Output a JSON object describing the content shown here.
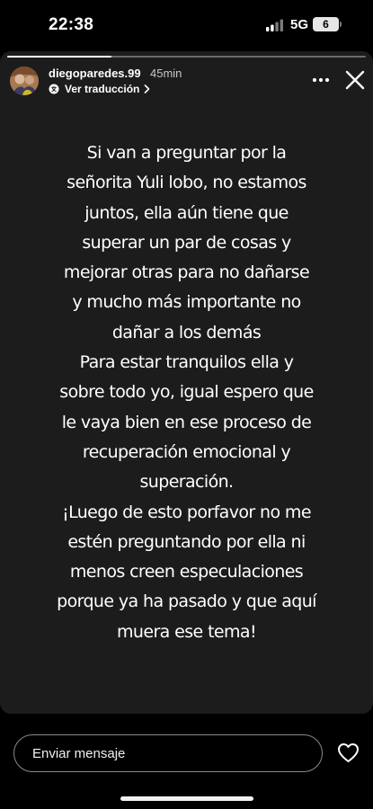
{
  "status_bar": {
    "time": "22:38",
    "network": "5G",
    "battery_level": "6",
    "icons": [
      "signal-icon",
      "battery-icon"
    ]
  },
  "story": {
    "username": "diegoparedes.99",
    "posted_ago": "45min",
    "translate_label": "Ver traducción",
    "progress": 0.29,
    "text": "Si van a preguntar por la\nseñorita Yuli lobo, no estamos\njuntos, ella aún tiene que\nsuperar un par de cosas y\nmejorar otras para no dañarse\ny mucho más importante no\ndañar a los demás\nPara estar tranquilos ella y\nsobre todo yo, igual espero que\nle vaya bien en ese proceso de\nrecuperación emocional y\nsuperación.\n¡Luego de esto porfavor no me\nestén preguntando por ella ni\nmenos creen especulaciones\nporque ya ha pasado y que aquí\nmuera ese tema!",
    "icons": [
      "more-icon",
      "close-icon",
      "translate-icon",
      "chevron-right-icon"
    ]
  },
  "reply": {
    "placeholder": "Enviar mensaje",
    "icons": [
      "heart-icon"
    ]
  },
  "colors": {
    "background": "#000000",
    "card": "#1c1c1c",
    "text": "#ffffff"
  }
}
